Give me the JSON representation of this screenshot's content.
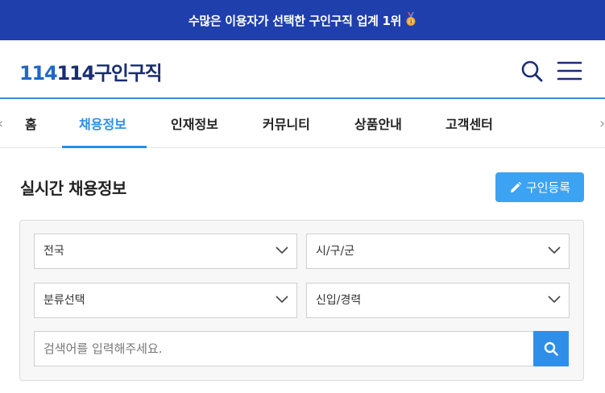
{
  "banner": {
    "text": "수많은 이용자가 선택한 구인구직 업계 1위"
  },
  "header": {
    "logo": {
      "part1": "114",
      "part2": "114",
      "part3": "구인구직"
    }
  },
  "nav": {
    "tabs": [
      {
        "label": "홈"
      },
      {
        "label": "채용정보",
        "active": true
      },
      {
        "label": "인재정보"
      },
      {
        "label": "커뮤니티"
      },
      {
        "label": "상품안내"
      },
      {
        "label": "고객센터"
      }
    ],
    "left_arrow": "‹",
    "right_arrow": "›"
  },
  "main": {
    "title": "실시간 채용정보",
    "register_label": "구인등록"
  },
  "filters": {
    "region": "전국",
    "district": "시/구/군",
    "category": "분류선택",
    "career": "신입/경력",
    "search_placeholder": "검색어를 입력해주세요."
  },
  "colors": {
    "banner": "#1f3fad",
    "accent": "#2a8ee6",
    "button": "#3ca3f2",
    "logo_dark": "#1a2d73"
  }
}
